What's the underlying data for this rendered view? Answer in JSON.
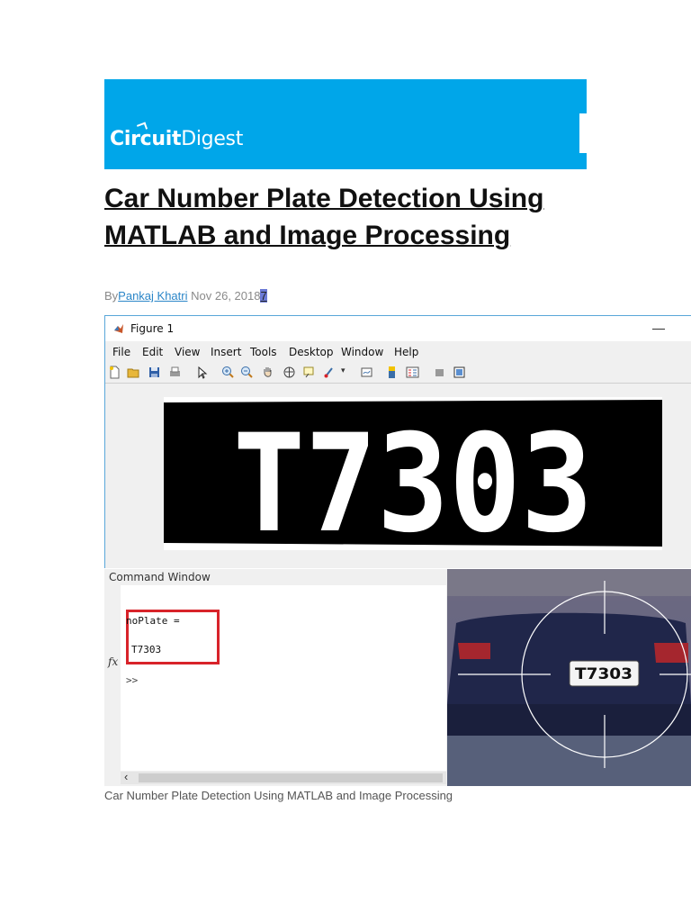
{
  "brand": {
    "logo_part1": "Circuit",
    "logo_part2": "Digest",
    "banner_color": "#00a6e9"
  },
  "article": {
    "title": "Car Number Plate Detection Using MATLAB and Image Processing",
    "by_prefix": "By",
    "author": "Pankaj Khatri",
    "date": "Nov 26, 2018",
    "selected_char": "7"
  },
  "figure_window": {
    "title": "Figure 1",
    "minimize_glyph": "—",
    "menu": [
      "File",
      "Edit",
      "View",
      "Insert",
      "Tools",
      "Desktop",
      "Window",
      "Help"
    ],
    "plate_text": "T7303"
  },
  "command_window": {
    "title": "Command Window",
    "var_line": "noPlate =",
    "value_line": "T7303",
    "fx_symbol": "fx",
    "prompt": ">>",
    "scroll_left_glyph": "‹"
  },
  "photo": {
    "plate_text": "T7303"
  },
  "caption": "Car Number Plate Detection Using MATLAB and Image Processing"
}
